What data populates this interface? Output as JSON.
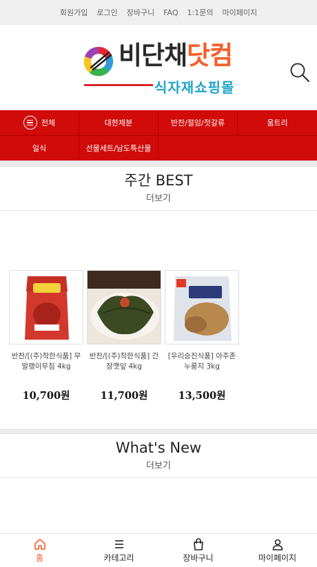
{
  "topbar": {
    "links": [
      "회원가입",
      "로그인",
      "장바구니",
      "FAQ",
      "1:1문의",
      "마이페이지"
    ]
  },
  "logo": {
    "main_dark": "비단채",
    "main_orange": "닷컴",
    "sub": "식자재쇼핑몰"
  },
  "nav": {
    "all_label": "전체",
    "row1": [
      "대한제분",
      "반찬/절임/젓갈류",
      "움트리"
    ],
    "row2": [
      "일식",
      "선물세트/남도특산물"
    ]
  },
  "best": {
    "title": "주간 BEST",
    "more": "더보기",
    "products": [
      {
        "name": "반찬/[(주)착한식품] 무말랭이무침 4kg",
        "price": "10,700원",
        "image": "pickled-radish-package"
      },
      {
        "name": "반찬/[(주)착한식품] 간장깻잎 4kg",
        "price": "11,700원",
        "image": "soy-perilla-leaves-plate"
      },
      {
        "name": "[우리승진식품] 아주존 누룽지 3kg",
        "price": "13,500원",
        "image": "nurungji-package"
      }
    ]
  },
  "whatsnew": {
    "title": "What's New",
    "more": "더보기"
  },
  "bottom_nav": {
    "items": [
      {
        "label": "홈",
        "icon": "home-icon"
      },
      {
        "label": "카테고리",
        "icon": "menu-icon"
      },
      {
        "label": "장바구니",
        "icon": "shopping-bag-icon"
      },
      {
        "label": "마이페이지",
        "icon": "user-icon"
      }
    ],
    "active": 0
  },
  "colors": {
    "nav_red": "#d10a0a",
    "accent_orange": "#f15a29",
    "logo_blue": "#1ea5c8"
  }
}
